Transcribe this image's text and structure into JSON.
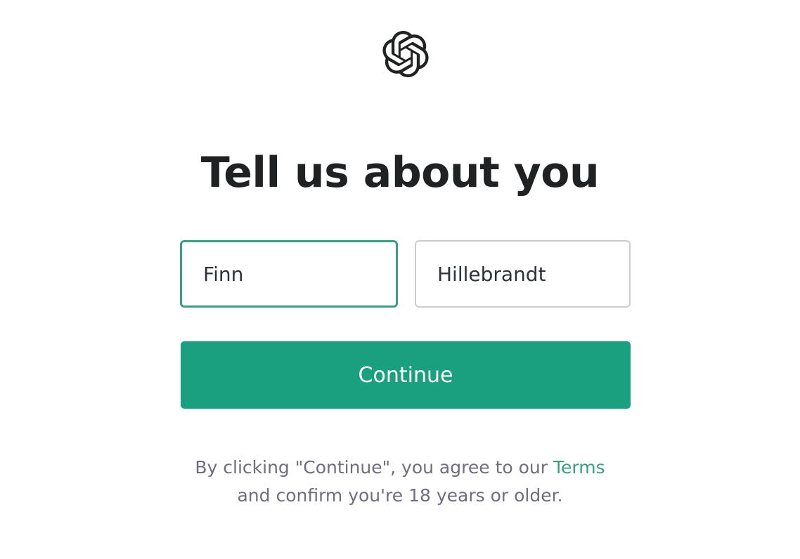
{
  "header": {
    "logo_icon": "openai-logo-icon"
  },
  "title": "Tell us about you",
  "form": {
    "first_name_value": "Finn",
    "last_name_value": "Hillebrandt",
    "continue_label": "Continue"
  },
  "disclaimer": {
    "text_before": "By clicking \"Continue\", you agree to our ",
    "terms_link": "Terms",
    "text_after": "and confirm you're 18 years or older."
  },
  "colors": {
    "accent": "#10a37f",
    "title": "#202123",
    "muted": "#6e6e80",
    "border": "#c9cdd2"
  }
}
